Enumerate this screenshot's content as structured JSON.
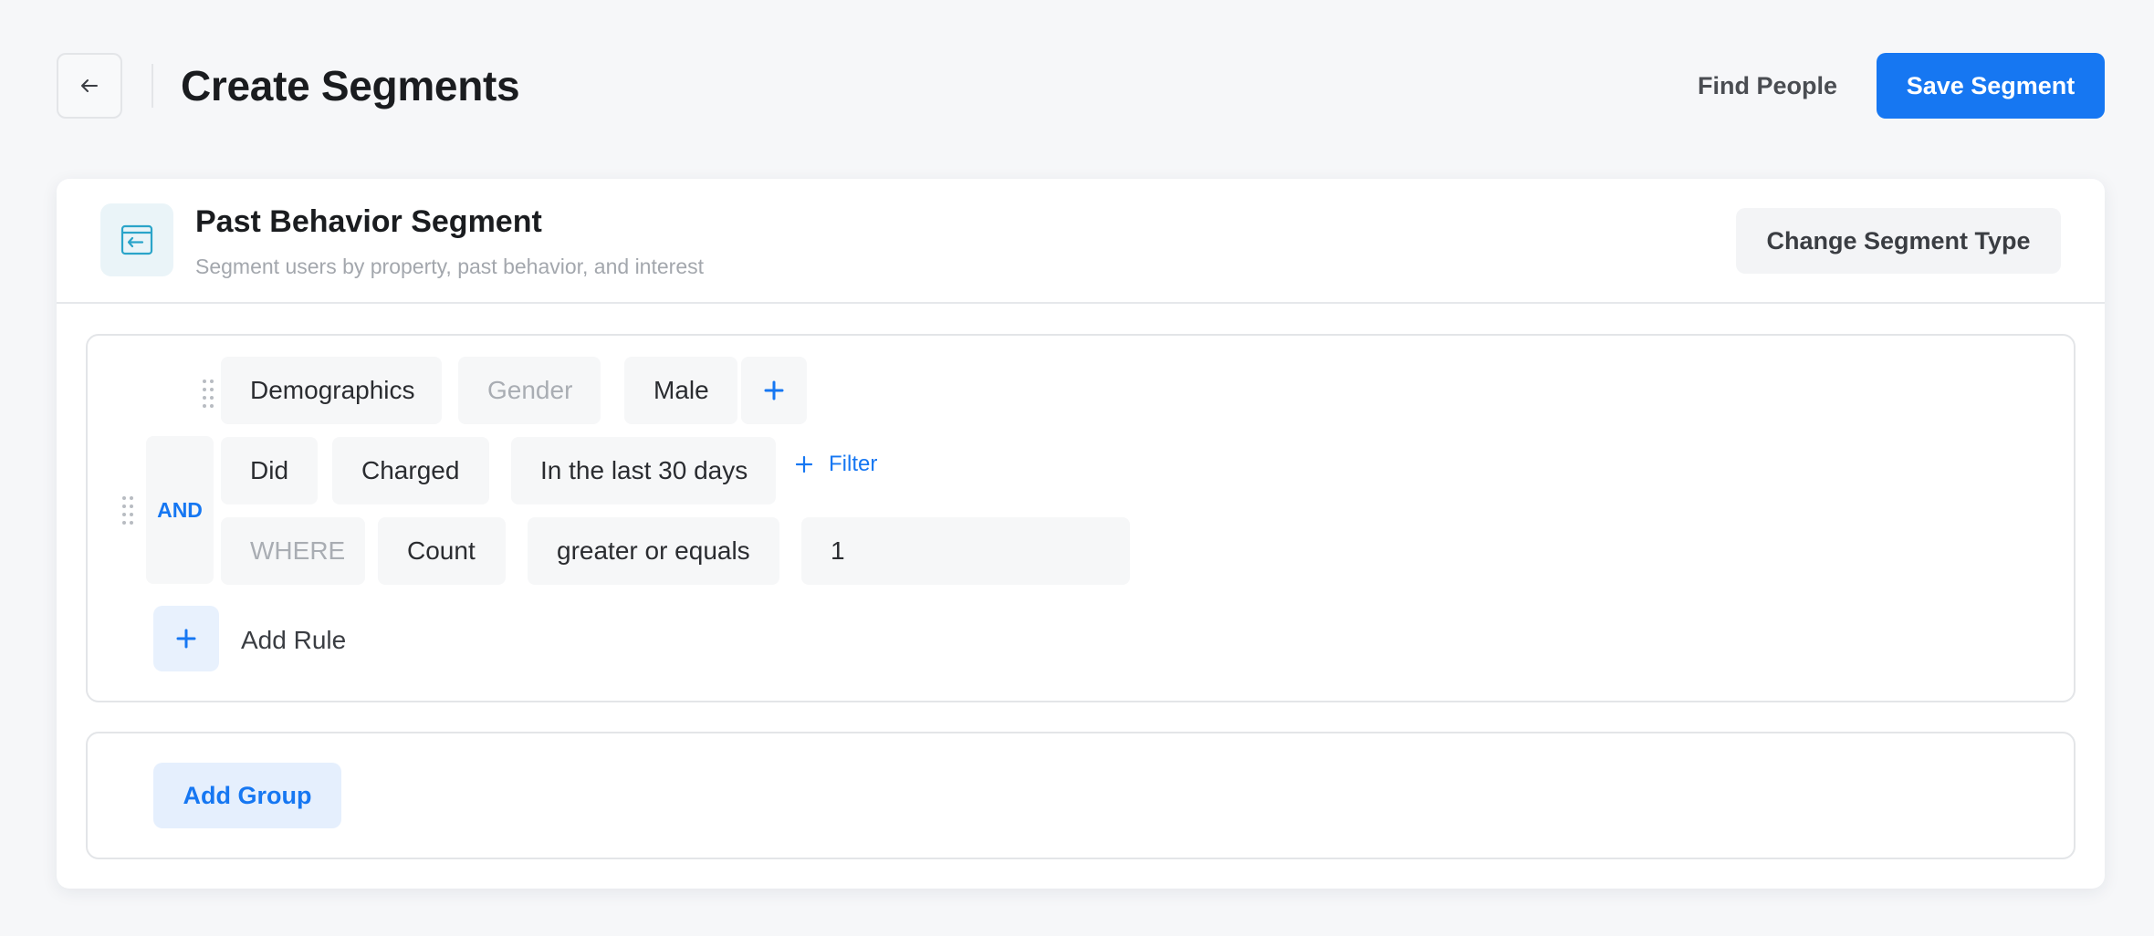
{
  "header": {
    "back_icon": "arrow-left-icon",
    "title": "Create Segments",
    "find_people_label": "Find People",
    "save_label": "Save Segment"
  },
  "segment": {
    "icon": "segment-window-icon",
    "title": "Past Behavior Segment",
    "subtitle": "Segment users by property, past behavior, and interest",
    "change_type_label": "Change Segment Type"
  },
  "group1": {
    "demographic_rule": {
      "category": "Demographics",
      "property": "Gender",
      "value": "Male"
    },
    "operator": "AND",
    "behavior_rule": {
      "action": "Did",
      "event": "Charged",
      "timeframe": "In the last 30 days",
      "filter_label": "Filter"
    },
    "where_rule": {
      "where_label": "WHERE",
      "aggregate": "Count",
      "comparator": "greater or equals",
      "value": "1"
    },
    "add_rule_label": "Add Rule"
  },
  "group2": {
    "add_group_label": "Add Group"
  },
  "colors": {
    "accent": "#1677f2",
    "background": "#f6f7f9",
    "pill": "#f6f7f8"
  }
}
